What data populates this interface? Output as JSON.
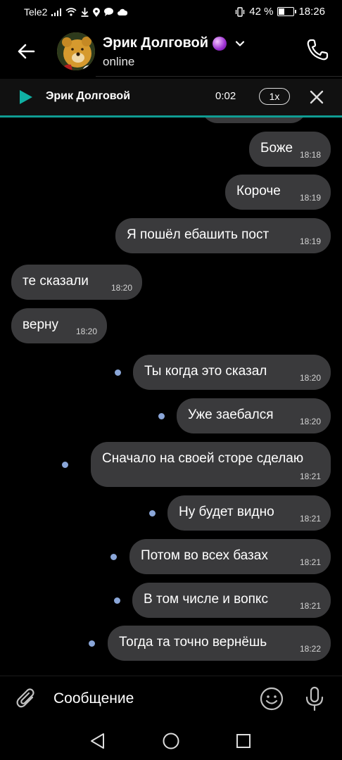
{
  "statusbar": {
    "carrier": "Tele2",
    "battery": "42 %",
    "battery_level": 0.42,
    "time": "18:26"
  },
  "header": {
    "contact_name": "Эрик Долговой",
    "status": "online",
    "icons": [
      "back-arrow-icon",
      "avatar",
      "crystal-ball-emoji",
      "chevron-down-icon",
      "phone-icon"
    ]
  },
  "player": {
    "name": "Эрик Долговой",
    "time": "0:02",
    "speed": "1x"
  },
  "messages": [
    {
      "text": "Боже",
      "time": "18:18",
      "side": "out",
      "unread": false
    },
    {
      "text": "Короче",
      "time": "18:19",
      "side": "out",
      "unread": false
    },
    {
      "text": "Я пошёл ебашить пост",
      "time": "18:19",
      "side": "out",
      "unread": false
    },
    {
      "text": "те сказали",
      "time": "18:20",
      "side": "in",
      "unread": false
    },
    {
      "text": "верну",
      "time": "18:20",
      "side": "in",
      "unread": false
    },
    {
      "text": "Ты когда это сказал",
      "time": "18:20",
      "side": "out",
      "unread": true
    },
    {
      "text": "Уже заебался",
      "time": "18:20",
      "side": "out",
      "unread": true
    },
    {
      "text": "Сначало на своей сторе сделаю",
      "time": "18:21",
      "side": "out",
      "unread": true
    },
    {
      "text": "Ну будет видно",
      "time": "18:21",
      "side": "out",
      "unread": true
    },
    {
      "text": "Потом во всех базах",
      "time": "18:21",
      "side": "out",
      "unread": true
    },
    {
      "text": "В том числе и вопкс",
      "time": "18:21",
      "side": "out",
      "unread": true
    },
    {
      "text": "Тогда та точно вернёшь",
      "time": "18:22",
      "side": "out",
      "unread": true
    }
  ],
  "composer": {
    "placeholder": "Сообщение"
  },
  "colors": {
    "background": "#000000",
    "bubble": "#3a3a3c",
    "accent": "#0f9c93",
    "unread_dot": "#8aa6d8"
  }
}
